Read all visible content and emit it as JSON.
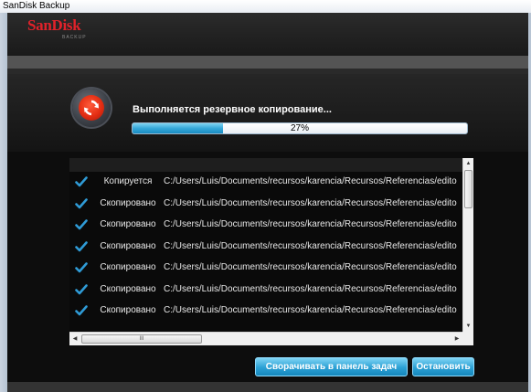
{
  "window": {
    "title": "SanDisk Backup"
  },
  "logo": {
    "brand": "SanDisk",
    "sub": "BACKUP"
  },
  "progress": {
    "status": "Выполняется резервное копирование...",
    "percent_label": "27%",
    "value": 0.27
  },
  "files": [
    {
      "state": "Копируется",
      "path": "C:/Users/Luis/Documents/recursos/karencia/Recursos/Referencias/edito"
    },
    {
      "state": "Скопировано",
      "path": "C:/Users/Luis/Documents/recursos/karencia/Recursos/Referencias/edito"
    },
    {
      "state": "Скопировано",
      "path": "C:/Users/Luis/Documents/recursos/karencia/Recursos/Referencias/edito"
    },
    {
      "state": "Скопировано",
      "path": "C:/Users/Luis/Documents/recursos/karencia/Recursos/Referencias/edito"
    },
    {
      "state": "Скопировано",
      "path": "C:/Users/Luis/Documents/recursos/karencia/Recursos/Referencias/edito"
    },
    {
      "state": "Скопировано",
      "path": "C:/Users/Luis/Documents/recursos/karencia/Recursos/Referencias/edito"
    },
    {
      "state": "Скопировано",
      "path": "C:/Users/Luis/Documents/recursos/karencia/Recursos/Referencias/edito"
    }
  ],
  "scroll": {
    "h_thumb_label": "III"
  },
  "buttons": {
    "minimize": "Сворачивать в панель задач",
    "stop": "Остановить"
  },
  "colors": {
    "accent": "#2ba0d4",
    "brand": "#e0222a",
    "check": "#2f9bd6"
  },
  "icons": {
    "check": "check-icon",
    "app": "sync-arrows-icon"
  }
}
